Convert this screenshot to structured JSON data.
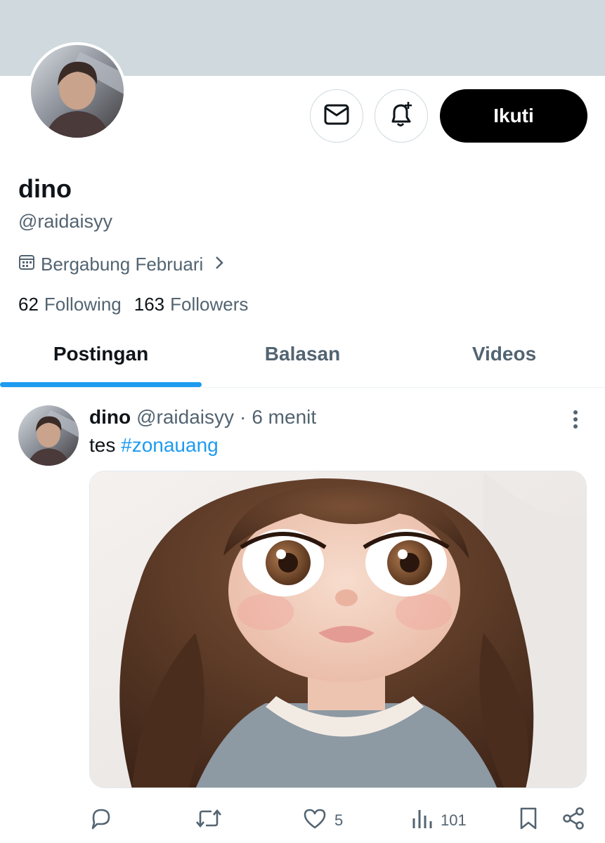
{
  "profile": {
    "display_name": "dino",
    "handle": "@raidaisyy",
    "joined": "Bergabung Februari",
    "following_count": "62",
    "following_label": "Following",
    "followers_count": "163",
    "followers_label": "Followers",
    "follow_button": "Ikuti"
  },
  "tabs": [
    {
      "label": "Postingan",
      "active": true
    },
    {
      "label": "Balasan",
      "active": false
    },
    {
      "label": "Videos",
      "active": false
    }
  ],
  "post": {
    "author": "dino",
    "handle": "@raidaisyy",
    "separator": "·",
    "time": "6 menit",
    "text": "tes",
    "hashtag": "#zonauang",
    "replies": "",
    "reposts": "",
    "likes": "5",
    "views": "101"
  },
  "icons": {
    "message": "envelope-icon",
    "notify": "bell-plus-icon",
    "calendar": "calendar-icon",
    "chevron": "chevron-right-icon",
    "more": "more-vertical-icon",
    "reply": "reply-icon",
    "repost": "repost-icon",
    "like": "heart-icon",
    "views": "analytics-icon",
    "bookmark": "bookmark-icon",
    "share": "share-icon"
  },
  "colors": {
    "accent": "#1d9bf0",
    "banner": "#cfd9de",
    "secondary_text": "#536471",
    "follow_button_bg": "#000000"
  }
}
